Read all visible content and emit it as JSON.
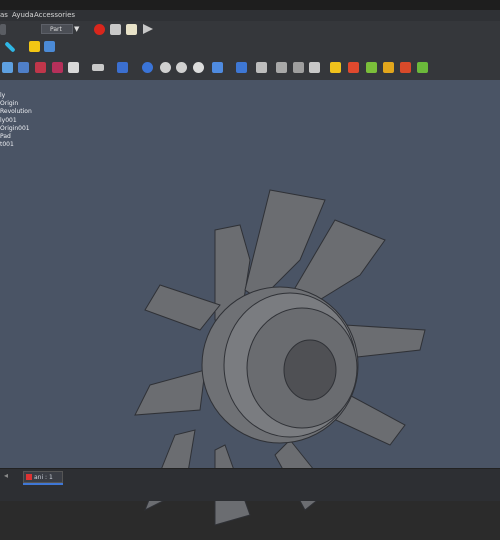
{
  "menubar": {
    "items": [
      "as",
      "Ayuda",
      "Accessories"
    ]
  },
  "toolbar": {
    "doc_selector_value": "Part",
    "doc_selector_arrow": "▼"
  },
  "tree": {
    "items": [
      "ly",
      "Origin",
      "Revolution",
      "ly001",
      "Origin001",
      "Pad",
      "t001"
    ]
  },
  "statusbar": {
    "tab_label": "ani : 1"
  },
  "colors": {
    "viewport_bg": "#4a5465",
    "toolbar_bg": "#35373b",
    "model_face": "#6b6d71",
    "model_dark": "#4f5054",
    "accent_tab": "#3f77d6"
  },
  "icons": [
    "record-macro-icon",
    "stop-macro-icon",
    "macro-editor-icon",
    "run-macro-icon",
    "measure-icon",
    "part-icon",
    "open-folder-icon",
    "sketch-icon",
    "pad-icon",
    "pocket-icon",
    "revolution-icon",
    "fillet-icon",
    "datum-icon",
    "mirror-icon",
    "pattern-icon",
    "boolean-icon",
    "chamfer-icon",
    "hole-icon",
    "thickness-icon",
    "pattern-linear-icon"
  ]
}
